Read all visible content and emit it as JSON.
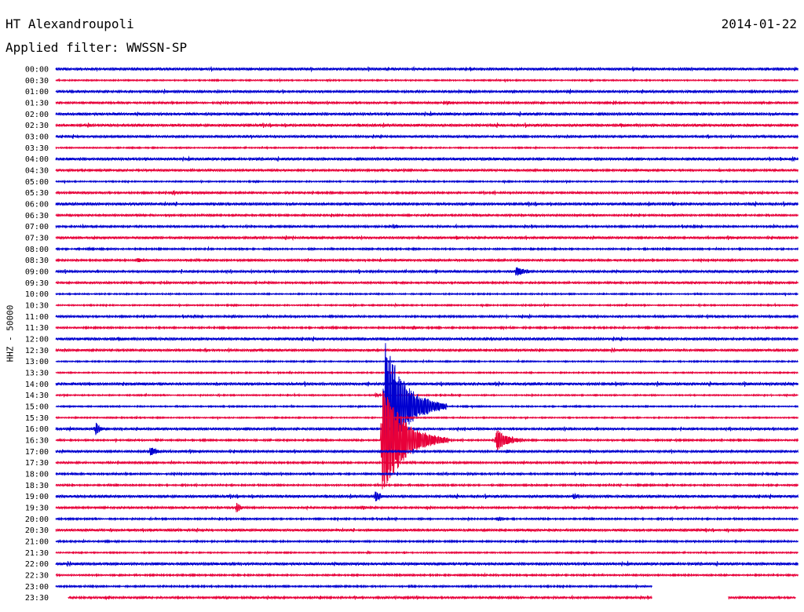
{
  "header": {
    "station": "HT Alexandroupoli",
    "date": "2014-01-22",
    "filter": "Applied filter: WWSSN-SP"
  },
  "colors": {
    "even_row": "#0000d0",
    "odd_row": "#e8003a"
  },
  "chart_data": {
    "type": "line",
    "subtype": "helicorder",
    "title": "HT Alexandroupoli",
    "ylabel": "HHZ - 50000",
    "row_minutes": 30,
    "rows": [
      "00:00",
      "00:30",
      "01:00",
      "01:30",
      "02:00",
      "02:30",
      "03:00",
      "03:30",
      "04:00",
      "04:30",
      "05:00",
      "05:30",
      "06:00",
      "06:30",
      "07:00",
      "07:30",
      "08:00",
      "08:30",
      "09:00",
      "09:30",
      "10:00",
      "10:30",
      "11:00",
      "11:30",
      "12:00",
      "12:30",
      "13:00",
      "13:30",
      "14:00",
      "14:30",
      "15:00",
      "15:30",
      "16:00",
      "16:30",
      "17:00",
      "17:30",
      "18:00",
      "18:30",
      "19:00",
      "19:30",
      "20:00",
      "20:30",
      "21:00",
      "21:30",
      "22:00",
      "22:30",
      "23:00",
      "23:30"
    ],
    "background_noise": [
      1.5,
      0.8,
      1.5,
      1.2,
      1.6,
      1.6,
      1.4,
      0.8,
      1.6,
      1.3,
      0.8,
      1.2,
      1.6,
      1.2,
      1.2,
      1.4,
      1.0,
      1.2,
      1.4,
      1.2,
      0.8,
      0.8,
      1.2,
      1.0,
      1.6,
      1.4,
      0.8,
      0.8,
      1.6,
      0.8,
      0.8,
      0.8,
      1.4,
      1.0,
      1.4,
      1.2,
      1.2,
      1.0,
      1.6,
      1.2,
      1.0,
      1.4,
      1.0,
      0.8,
      1.6,
      1.0,
      1.0,
      1.2
    ],
    "events": [
      {
        "row": "01:30",
        "minute": 15.8,
        "amplitude": 3,
        "duration_min": 1.0
      },
      {
        "row": "02:00",
        "minute": 24.8,
        "amplitude": 3,
        "duration_min": 0.5
      },
      {
        "row": "02:30",
        "minute": 1.3,
        "amplitude": 3,
        "duration_min": 0.6
      },
      {
        "row": "05:30",
        "minute": 4.7,
        "amplitude": 3,
        "duration_min": 1.6
      },
      {
        "row": "06:00",
        "minute": 24.9,
        "amplitude": 3,
        "duration_min": 0.8
      },
      {
        "row": "07:00",
        "minute": 13.6,
        "amplitude": 3,
        "duration_min": 1.5
      },
      {
        "row": "07:30",
        "minute": 16.2,
        "amplitude": 3,
        "duration_min": 0.8
      },
      {
        "row": "08:30",
        "minute": 3.3,
        "amplitude": 3,
        "duration_min": 2.1
      },
      {
        "row": "09:00",
        "minute": 18.6,
        "amplitude": 8,
        "duration_min": 1.2
      },
      {
        "row": "11:00",
        "minute": 7.1,
        "amplitude": 3,
        "duration_min": 0.8
      },
      {
        "row": "11:30",
        "minute": 14.4,
        "amplitude": 3,
        "duration_min": 1.1
      },
      {
        "row": "14:30",
        "minute": 12.9,
        "amplitude": 4,
        "duration_min": 0.5
      },
      {
        "row": "15:00",
        "minute": 13.3,
        "amplitude": 90,
        "duration_min": 2.5
      },
      {
        "row": "16:00",
        "minute": 1.6,
        "amplitude": 9,
        "duration_min": 0.6
      },
      {
        "row": "16:30",
        "minute": 13.2,
        "amplitude": 75,
        "duration_min": 2.7
      },
      {
        "row": "16:30",
        "minute": 17.8,
        "amplitude": 14,
        "duration_min": 1.7
      },
      {
        "row": "17:00",
        "minute": 3.8,
        "amplitude": 8,
        "duration_min": 0.8
      },
      {
        "row": "17:00",
        "minute": 18.2,
        "amplitude": 3,
        "duration_min": 0.8
      },
      {
        "row": "18:00",
        "minute": 29.1,
        "amplitude": 3,
        "duration_min": 0.6
      },
      {
        "row": "19:00",
        "minute": 12.9,
        "amplitude": 8,
        "duration_min": 0.8
      },
      {
        "row": "19:00",
        "minute": 20.9,
        "amplitude": 5,
        "duration_min": 0.6
      },
      {
        "row": "19:30",
        "minute": 7.3,
        "amplitude": 6,
        "duration_min": 0.8
      },
      {
        "row": "19:30",
        "minute": 12.4,
        "amplitude": 3,
        "duration_min": 0.8
      },
      {
        "row": "20:00",
        "minute": 17.9,
        "amplitude": 3,
        "duration_min": 0.9
      },
      {
        "row": "21:30",
        "minute": 12.6,
        "amplitude": 2,
        "duration_min": 0.4
      },
      {
        "row": "22:30",
        "minute": 16.4,
        "amplitude": 2,
        "duration_min": 0.4
      }
    ],
    "data_until": {
      "row": "23:00",
      "minute": 24.1
    },
    "row_23_30_segments": [
      [
        0.5,
        24.1
      ],
      [
        27.2,
        29.9
      ]
    ]
  }
}
